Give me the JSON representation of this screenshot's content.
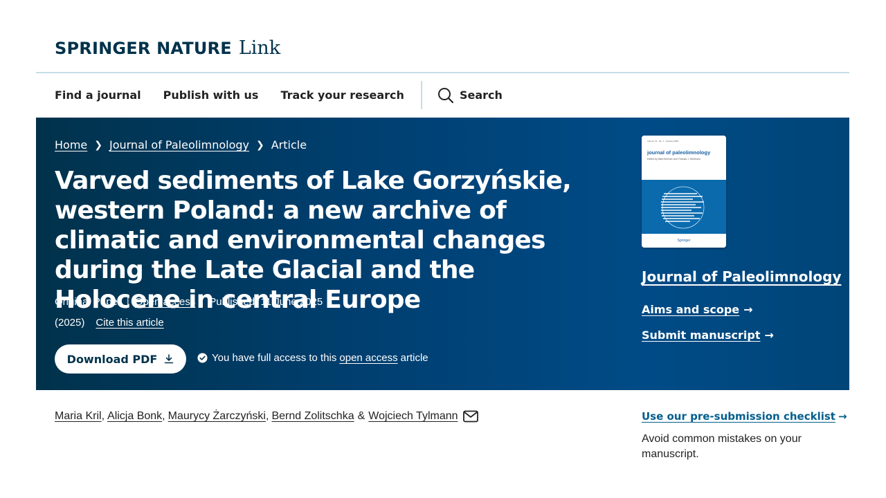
{
  "header": {
    "brand": "SPRINGER NATURE",
    "brand_suffix": "Link"
  },
  "nav": {
    "items": [
      {
        "label": "Find a journal"
      },
      {
        "label": "Publish with us"
      },
      {
        "label": "Track your research"
      }
    ],
    "search_label": "Search"
  },
  "breadcrumb": {
    "home": "Home",
    "journal": "Journal of Paleolimnology",
    "current": "Article"
  },
  "article": {
    "title": "Varved sediments of Lake Gorzyńskie, western Poland: a new archive of climatic and environmental changes during the Late Glacial and the Holocene in central Europe",
    "type": "Original Paper",
    "access": "Open access",
    "published": "Published: 11 June 2025",
    "year": "(2025)",
    "cite": "Cite this article",
    "download_label": "Download PDF",
    "access_note_pre": "You have full access to this",
    "access_note_link": "open access",
    "access_note_post": "article"
  },
  "sidebar": {
    "cover": {
      "meta": "Volume 73 · No. 1 · January 2025",
      "title": "journal of paleolimnology",
      "editors": "Edited by Mark Brenner and Thomas J. Whitmore",
      "publisher": "Springer"
    },
    "journal_name": "Journal of Paleolimnology",
    "aims_scope": "Aims and scope",
    "submit": "Submit manuscript"
  },
  "authors": {
    "list": [
      "Maria Kril",
      "Alicja Bonk",
      "Maurycy Żarczyński",
      "Bernd Zolitschka"
    ],
    "last": "Wojciech Tylmann",
    "separator": ",",
    "amp": "&"
  },
  "checklist": {
    "link": "Use our pre-submission checklist",
    "description": "Avoid common mistakes on your manuscript."
  },
  "colors": {
    "brand_dark": "#01324b",
    "hero_blue": "#004b87",
    "link_blue": "#025e8d",
    "divider": "#c4dde6"
  },
  "icons": {
    "search": "search-icon",
    "download": "download-icon",
    "check": "check-circle-icon",
    "arrow": "arrow-right-icon",
    "mail": "mail-icon",
    "chevron": "chevron-right-icon"
  }
}
